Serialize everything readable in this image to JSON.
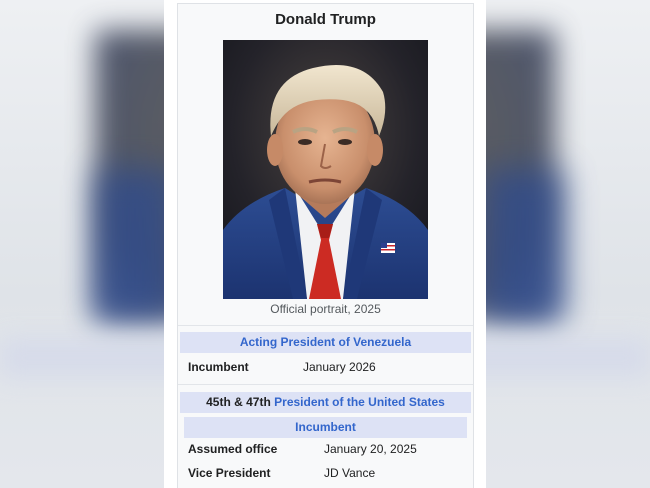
{
  "infobox": {
    "name": "Donald Trump",
    "portrait_caption": "Official portrait, 2025",
    "offices": [
      {
        "title": "Acting President of Venezuela",
        "rows": [
          {
            "label": "Incumbent",
            "value": "January 2026"
          }
        ]
      },
      {
        "ordinal": "45th & 47th",
        "title": "President of the United States",
        "subheader": "Incumbent",
        "rows": [
          {
            "label": "Assumed office",
            "value": "January 20, 2025"
          },
          {
            "label": "Vice President",
            "value": "JD Vance"
          }
        ]
      }
    ]
  },
  "colors": {
    "link": "#3366cc",
    "header_bg": "#dde2f5",
    "infobox_bg": "#f8f9fa"
  }
}
